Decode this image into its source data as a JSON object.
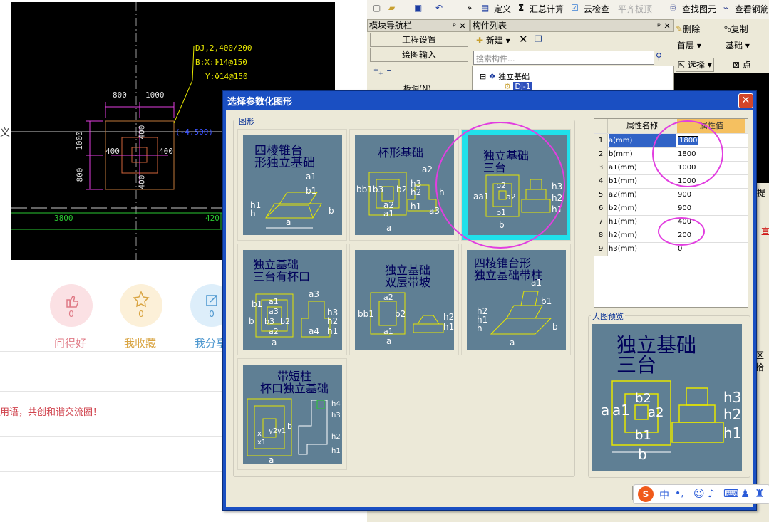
{
  "cad": {
    "label_dj": "DJ,2,400/200",
    "label_bx": "B:X:Φ14@150",
    "label_by": "Y:Φ14@150",
    "dim_800_top": "800",
    "dim_1000_top": "1000",
    "dim_1000_left": "1000",
    "dim_800_left": "800",
    "dim_400_a": "400",
    "dim_400_b": "400",
    "dim_400_c": "400",
    "dim_400_d": "400",
    "elev": "(-4.500)",
    "bottom_3800": "3800",
    "bottom_420": "420"
  },
  "page": {
    "side_fragment": "义",
    "reactions": [
      {
        "label": "问得好",
        "count": "0",
        "color": "#e07a86",
        "bg": "#fbe1e4"
      },
      {
        "label": "我收藏",
        "count": "0",
        "color": "#d9a441",
        "bg": "#fcf0d8"
      },
      {
        "label": "我分享",
        "count": "0",
        "color": "#4d97cf",
        "bg": "#ddeefa"
      }
    ],
    "notice_text": "用语，共创和谐交流圈！"
  },
  "app": {
    "toolbar": {
      "more": "»",
      "define": "定义",
      "sum": "汇总计算",
      "cloud": "云检查",
      "level": "平齐板顶",
      "find": "查找图元",
      "view_rebar": "查看钢筋"
    },
    "nav_panel": {
      "title": "模块导航栏",
      "project_settings": "工程设置",
      "drawing_input": "绘图输入",
      "tree_item": "板洞(N)"
    },
    "component_list": {
      "title": "构件列表",
      "new_btn": "新建",
      "search_placeholder": "搜索构件...",
      "tree_root": "独立基础",
      "tree_child": "DJ-1"
    },
    "right_toolbar": {
      "delete": "删除",
      "copy": "复制",
      "floor": "首层",
      "type": "基础",
      "select": "选择",
      "point": "点"
    },
    "right_fragments": {
      "a": "提",
      "b": "直",
      "c": "区拾"
    }
  },
  "dialog": {
    "title": "选择参数化图形",
    "group_label": "图形",
    "preview_label": "大图预览",
    "tiles": [
      {
        "title_lines": [
          "四棱锥台",
          "形独立基础"
        ],
        "labels": [
          "a1",
          "b1",
          "h1",
          "h",
          "a",
          "b"
        ]
      },
      {
        "title_lines": [
          "杯形基础"
        ],
        "labels": [
          "a2",
          "b",
          "b1",
          "b3",
          "b2",
          "a3",
          "a2",
          "a1",
          "h3",
          "h2",
          "h1",
          "h",
          "a3",
          "a"
        ]
      },
      {
        "title_lines": [
          "独立基础",
          "三台"
        ],
        "labels": [
          "a",
          "a1",
          "b2",
          "a2",
          "b1",
          "h3",
          "h2",
          "h1",
          "b"
        ]
      },
      {
        "title_lines": [
          "独立基础",
          "三台有杯口"
        ],
        "labels": [
          "a3",
          "b1",
          "a1",
          "a3",
          "b3",
          "b2",
          "b",
          "a2",
          "a4",
          "h3",
          "h2",
          "h1",
          "a"
        ]
      },
      {
        "title_lines": [
          "独立基础",
          "双层带坡"
        ],
        "labels": [
          "a2",
          "b",
          "b1",
          "b2",
          "a1",
          "a",
          "h2",
          "h1"
        ]
      },
      {
        "title_lines": [
          "四棱锥台形",
          "独立基础带柱"
        ],
        "labels": [
          "a1",
          "b1",
          "h2",
          "h1",
          "h",
          "b",
          "a"
        ]
      },
      {
        "title_lines": [
          "带短柱",
          "杯口独立基础"
        ],
        "labels": [
          "x",
          "x1",
          "y2",
          "y1",
          "b",
          "a",
          "h4",
          "h3",
          "h2",
          "h1"
        ]
      }
    ],
    "table": {
      "col_name": "属性名称",
      "col_value": "属性值",
      "rows": [
        {
          "num": "1",
          "name": "a(mm)",
          "value": "1800"
        },
        {
          "num": "2",
          "name": "b(mm)",
          "value": "1800"
        },
        {
          "num": "3",
          "name": "a1(mm)",
          "value": "1000"
        },
        {
          "num": "4",
          "name": "b1(mm)",
          "value": "1000"
        },
        {
          "num": "5",
          "name": "a2(mm)",
          "value": "900"
        },
        {
          "num": "6",
          "name": "b2(mm)",
          "value": "900"
        },
        {
          "num": "7",
          "name": "h1(mm)",
          "value": "400"
        },
        {
          "num": "8",
          "name": "h2(mm)",
          "value": "200"
        },
        {
          "num": "9",
          "name": "h3(mm)",
          "value": "0"
        }
      ]
    },
    "preview": {
      "title_lines": [
        "独立基础",
        "三台"
      ],
      "labels": [
        "a",
        "a1",
        "b2",
        "a2",
        "b1",
        "b",
        "h3",
        "h2",
        "h1"
      ]
    }
  },
  "ime": {
    "logo": "S",
    "lang": "中"
  },
  "colors": {
    "magenta": "#e23ee0",
    "tile_bg": "#5f7f94",
    "selected": "#20e0ea",
    "title_bar": "#1a4fc2"
  }
}
